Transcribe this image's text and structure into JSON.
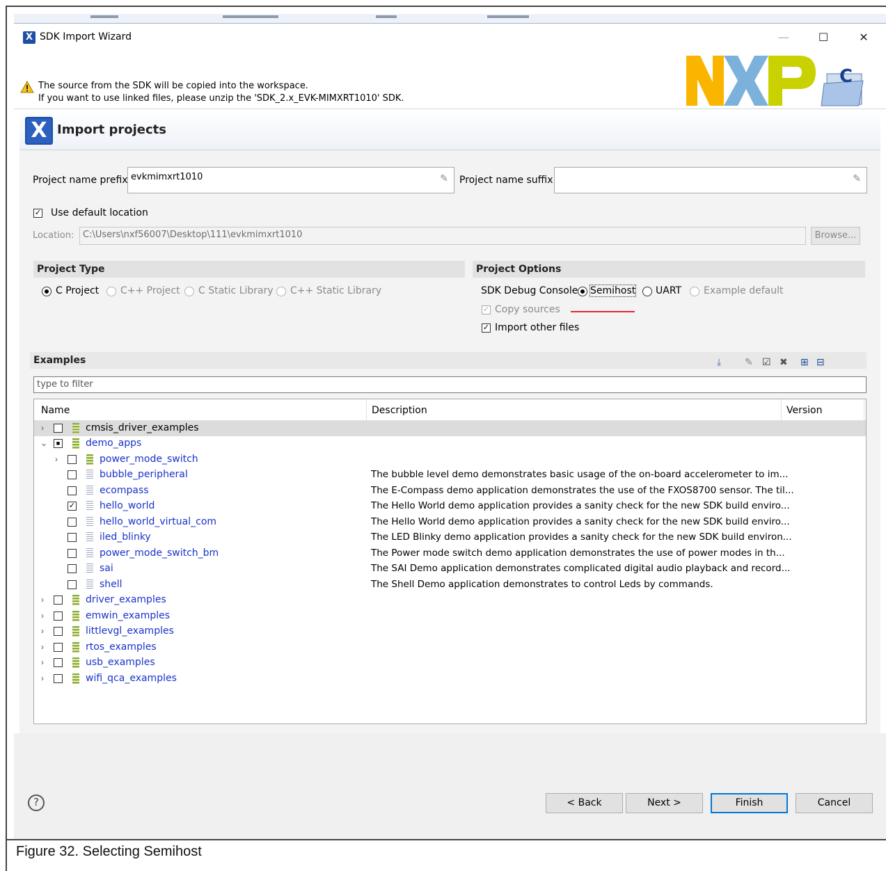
{
  "window": {
    "title": "SDK Import Wizard",
    "minimize": "—",
    "maximize": "☐",
    "close": "✕",
    "app_icon": "X"
  },
  "warning": {
    "line1": "The source from the SDK will be copied into the workspace.",
    "line2": "If you want to use linked files, please unzip the 'SDK_2.x_EVK-MIMXRT1010' SDK."
  },
  "brand": {
    "logo": "NXP",
    "colors": {
      "n": "#f9b500",
      "x": "#7bb1db",
      "p": "#c9d200"
    }
  },
  "header": {
    "title": "Import projects",
    "icon": "X"
  },
  "form": {
    "prefix_label": "Project name prefix:",
    "prefix_value": "evkmimxrt1010",
    "suffix_label": "Project name suffix:",
    "suffix_value": "",
    "use_default_location": "Use default location",
    "location_label": "Location:",
    "location_value": "C:\\Users\\nxf56007\\Desktop\\111\\evkmimxrt1010",
    "browse": "Browse..."
  },
  "project_type": {
    "title": "Project Type",
    "options": [
      "C Project",
      "C++ Project",
      "C Static Library",
      "C++ Static Library"
    ],
    "selected": "C Project"
  },
  "project_options": {
    "title": "Project Options",
    "console_label": "SDK Debug Console",
    "console_options": [
      "Semihost",
      "UART",
      "Example default"
    ],
    "console_selected": "Semihost",
    "copy_sources": "Copy sources",
    "import_other_files": "Import other files"
  },
  "examples": {
    "title": "Examples",
    "filter_placeholder": "type to filter",
    "columns": [
      "Name",
      "Description",
      "Version"
    ],
    "rows": [
      {
        "name": "cmsis_driver_examples",
        "desc": ""
      },
      {
        "name": "demo_apps",
        "desc": ""
      },
      {
        "name": "power_mode_switch",
        "desc": ""
      },
      {
        "name": "bubble_peripheral",
        "desc": "The bubble level demo demonstrates basic usage of the on-board accelerometer to im..."
      },
      {
        "name": "ecompass",
        "desc": "The E-Compass demo application demonstrates the use of the FXOS8700 sensor. The til..."
      },
      {
        "name": "hello_world",
        "desc": "The Hello World demo application provides a sanity check for the new SDK build enviro..."
      },
      {
        "name": "hello_world_virtual_com",
        "desc": "The Hello World demo application provides a sanity check for the new SDK build enviro..."
      },
      {
        "name": "iled_blinky",
        "desc": "The LED Blinky demo application provides a sanity check for the new SDK build environ..."
      },
      {
        "name": "power_mode_switch_bm",
        "desc": "The Power mode switch demo application demonstrates the use of power modes in th..."
      },
      {
        "name": "sai",
        "desc": "The SAI Demo application demonstrates complicated digital audio playback and record..."
      },
      {
        "name": "shell",
        "desc": "The Shell Demo application demonstrates to control Leds by commands."
      },
      {
        "name": "driver_examples",
        "desc": ""
      },
      {
        "name": "emwin_examples",
        "desc": ""
      },
      {
        "name": "littlevgl_examples",
        "desc": ""
      },
      {
        "name": "rtos_examples",
        "desc": ""
      },
      {
        "name": "usb_examples",
        "desc": ""
      },
      {
        "name": "wifi_qca_examples",
        "desc": ""
      }
    ]
  },
  "buttons": {
    "help": "?",
    "back": "< Back",
    "next": "Next >",
    "finish": "Finish",
    "cancel": "Cancel"
  },
  "caption": "Figure 32.  Selecting Semihost"
}
